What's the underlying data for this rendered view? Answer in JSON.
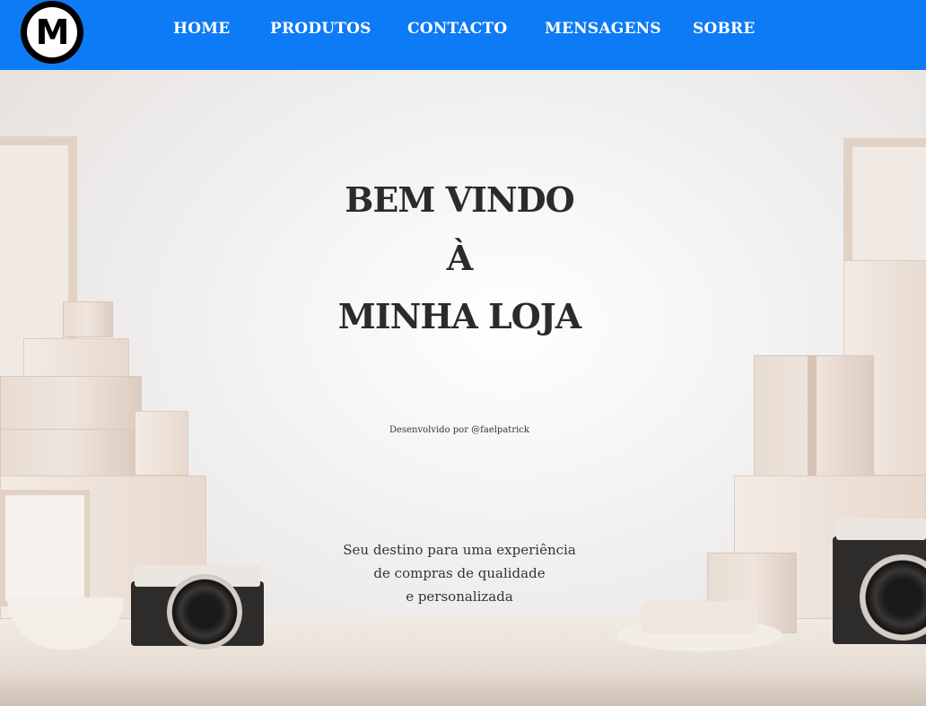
{
  "logo": {
    "letter": "M"
  },
  "nav": {
    "items": [
      {
        "label": "HOME"
      },
      {
        "label": "PRODUTOS"
      },
      {
        "label": "CONTACTO"
      },
      {
        "label": "MENSAGENS"
      },
      {
        "label": "SOBRE"
      }
    ]
  },
  "hero": {
    "title_lines": [
      "BEM VINDO",
      "À",
      "MINHA LOJA"
    ],
    "credit": "Desenvolvido por @faelpatrick",
    "tagline_lines": [
      "Seu destino para uma experiência",
      "de compras de qualidade",
      "e personalizada"
    ]
  },
  "colors": {
    "navbar": "#0d7bf5",
    "nav_text": "#ffffff",
    "title_text": "#2b2b2b"
  }
}
